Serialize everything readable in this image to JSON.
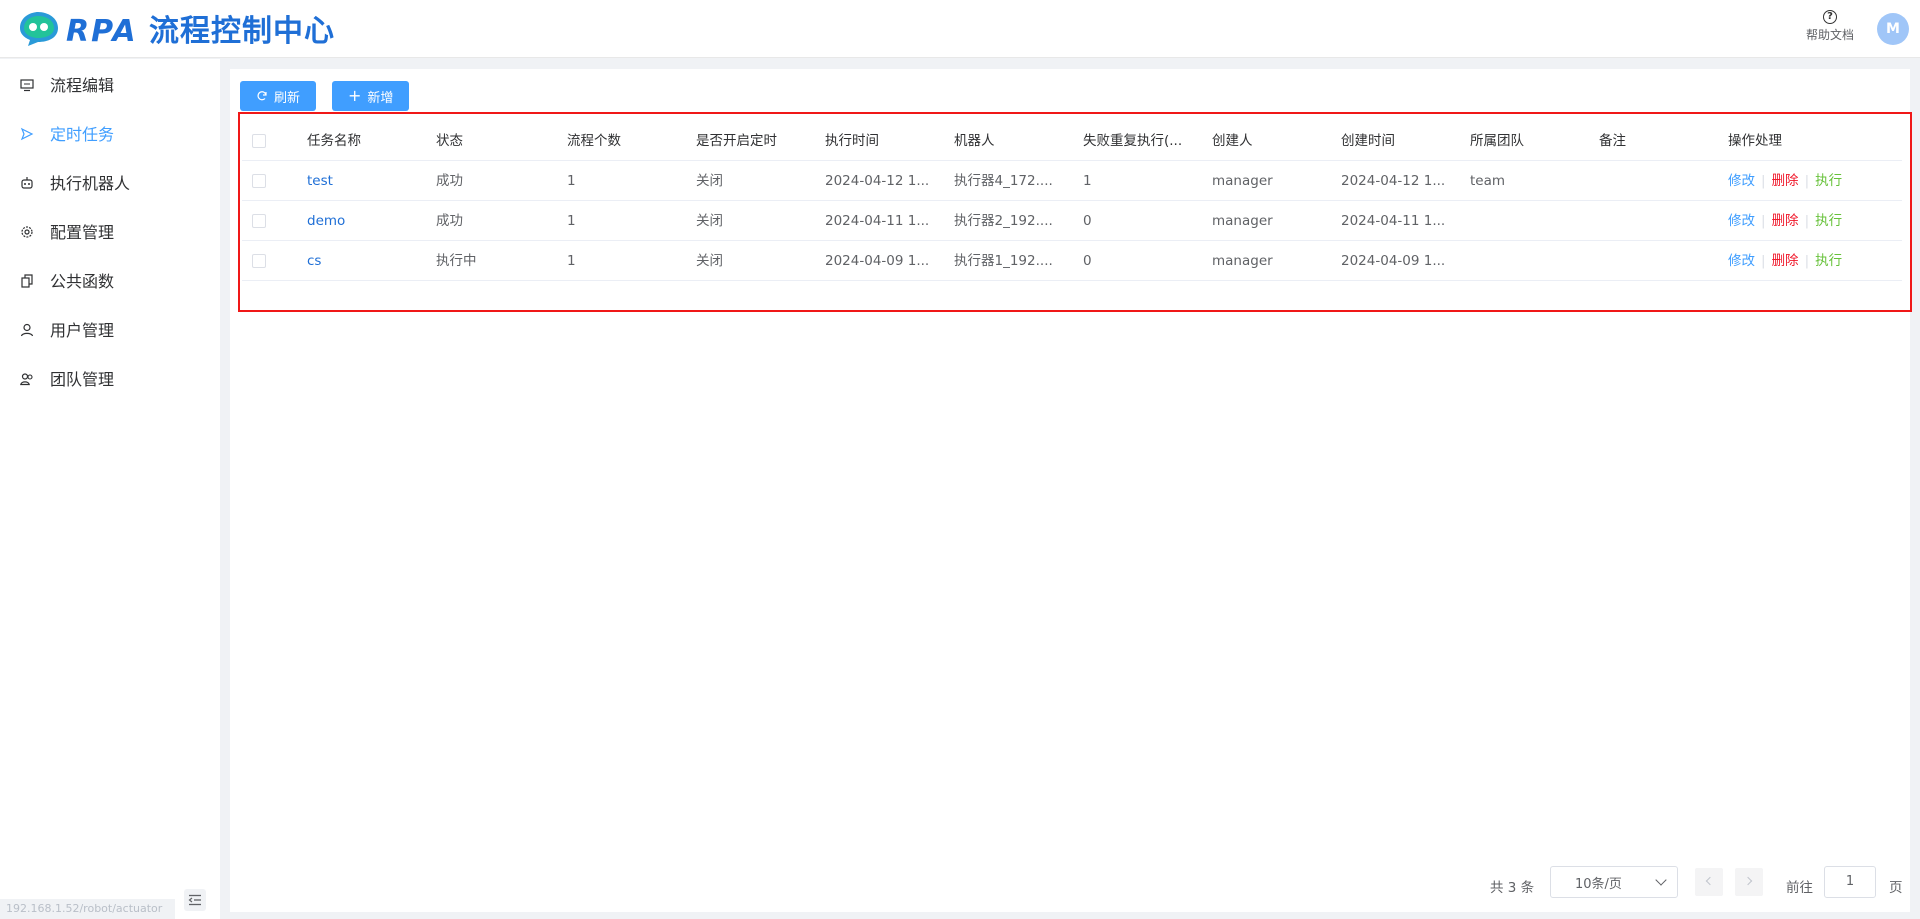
{
  "header": {
    "logo_rpa": "RPA",
    "logo_title": "流程控制中心",
    "help_label": "帮助文档",
    "avatar_initial": "M"
  },
  "sidebar": {
    "items": [
      {
        "label": "流程编辑",
        "icon": "monitor-icon"
      },
      {
        "label": "定时任务",
        "icon": "send-icon"
      },
      {
        "label": "执行机器人",
        "icon": "robot-icon"
      },
      {
        "label": "配置管理",
        "icon": "gear-icon"
      },
      {
        "label": "公共函数",
        "icon": "copy-icon"
      },
      {
        "label": "用户管理",
        "icon": "user-icon"
      },
      {
        "label": "团队管理",
        "icon": "team-icon"
      }
    ],
    "active_index": 1,
    "status_url": "192.168.1.52/robot/actuator"
  },
  "toolbar": {
    "refresh_label": "刷新",
    "add_label": "新增"
  },
  "table": {
    "columns": [
      "任务名称",
      "状态",
      "流程个数",
      "是否开启定时",
      "执行时间",
      "机器人",
      "失败重复执行(...",
      "创建人",
      "创建时间",
      "所属团队",
      "备注",
      "操作处理"
    ],
    "rows": [
      {
        "name": "test",
        "status": "成功",
        "count": "1",
        "timer": "关闭",
        "exec_time": "2024-04-12 1...",
        "robot": "执行器4_172....",
        "retry": "1",
        "creator": "manager",
        "created": "2024-04-12 1...",
        "team": "team",
        "remark": ""
      },
      {
        "name": "demo",
        "status": "成功",
        "count": "1",
        "timer": "关闭",
        "exec_time": "2024-04-11 1...",
        "robot": "执行器2_192....",
        "retry": "0",
        "creator": "manager",
        "created": "2024-04-11 1...",
        "team": "",
        "remark": ""
      },
      {
        "name": "cs",
        "status": "执行中",
        "count": "1",
        "timer": "关闭",
        "exec_time": "2024-04-09 1...",
        "robot": "执行器1_192....",
        "retry": "0",
        "creator": "manager",
        "created": "2024-04-09 1...",
        "team": "",
        "remark": ""
      }
    ],
    "actions": {
      "edit": "修改",
      "delete": "删除",
      "run": "执行"
    }
  },
  "pagination": {
    "total_label": "共 3 条",
    "page_size": "10条/页",
    "goto_label": "前往",
    "current_page": "1",
    "page_suffix": "页"
  },
  "colors": {
    "primary": "#409eff",
    "danger": "#f0172a",
    "success": "#67c23a",
    "highlight_frame": "#f01818"
  }
}
